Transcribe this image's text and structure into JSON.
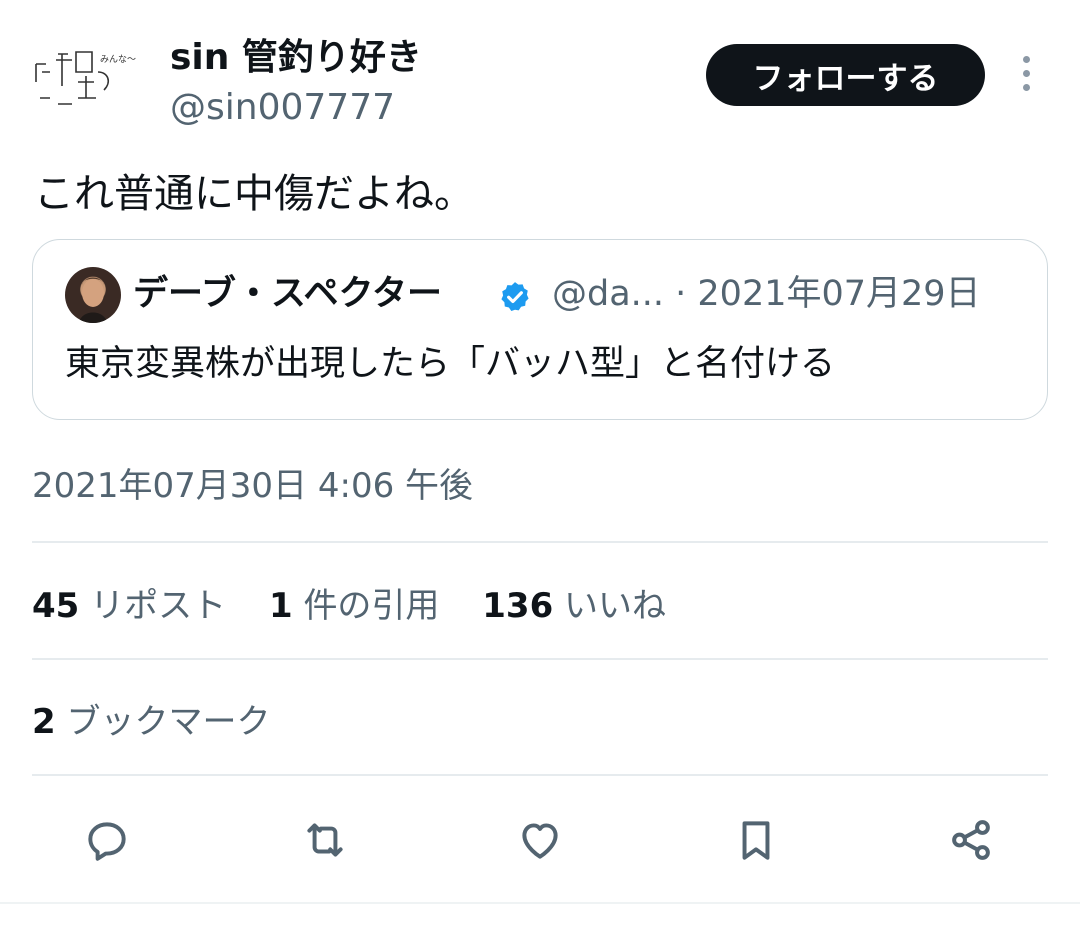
{
  "author": {
    "display_name": "sin 管釣り好き",
    "handle": "@sin007777",
    "avatar_text": "みんな〜"
  },
  "follow_label": "フォローする",
  "tweet_text": "これ普通に中傷だよね。",
  "quote": {
    "name": "デーブ・スペクター",
    "handle_date": "@da... · 2021年07月29日",
    "text": "東京変異株が出現したら「バッハ型」と名付ける"
  },
  "timestamp": "2021年07月30日 4:06 午後",
  "stats": {
    "reposts_count": "45",
    "reposts_label": "リポスト",
    "quotes_count": "1",
    "quotes_label": "件の引用",
    "likes_count": "136",
    "likes_label": "いいね"
  },
  "bookmarks": {
    "count": "2",
    "label": "ブックマーク"
  },
  "icons": [
    "reply-icon",
    "repost-icon",
    "like-icon",
    "bookmark-icon",
    "share-icon",
    "verified-icon",
    "more-icon"
  ],
  "colors": {
    "text": "#0f1419",
    "secondary": "#536471",
    "verified": "#1d9bf0",
    "border": "#cfd9de"
  }
}
